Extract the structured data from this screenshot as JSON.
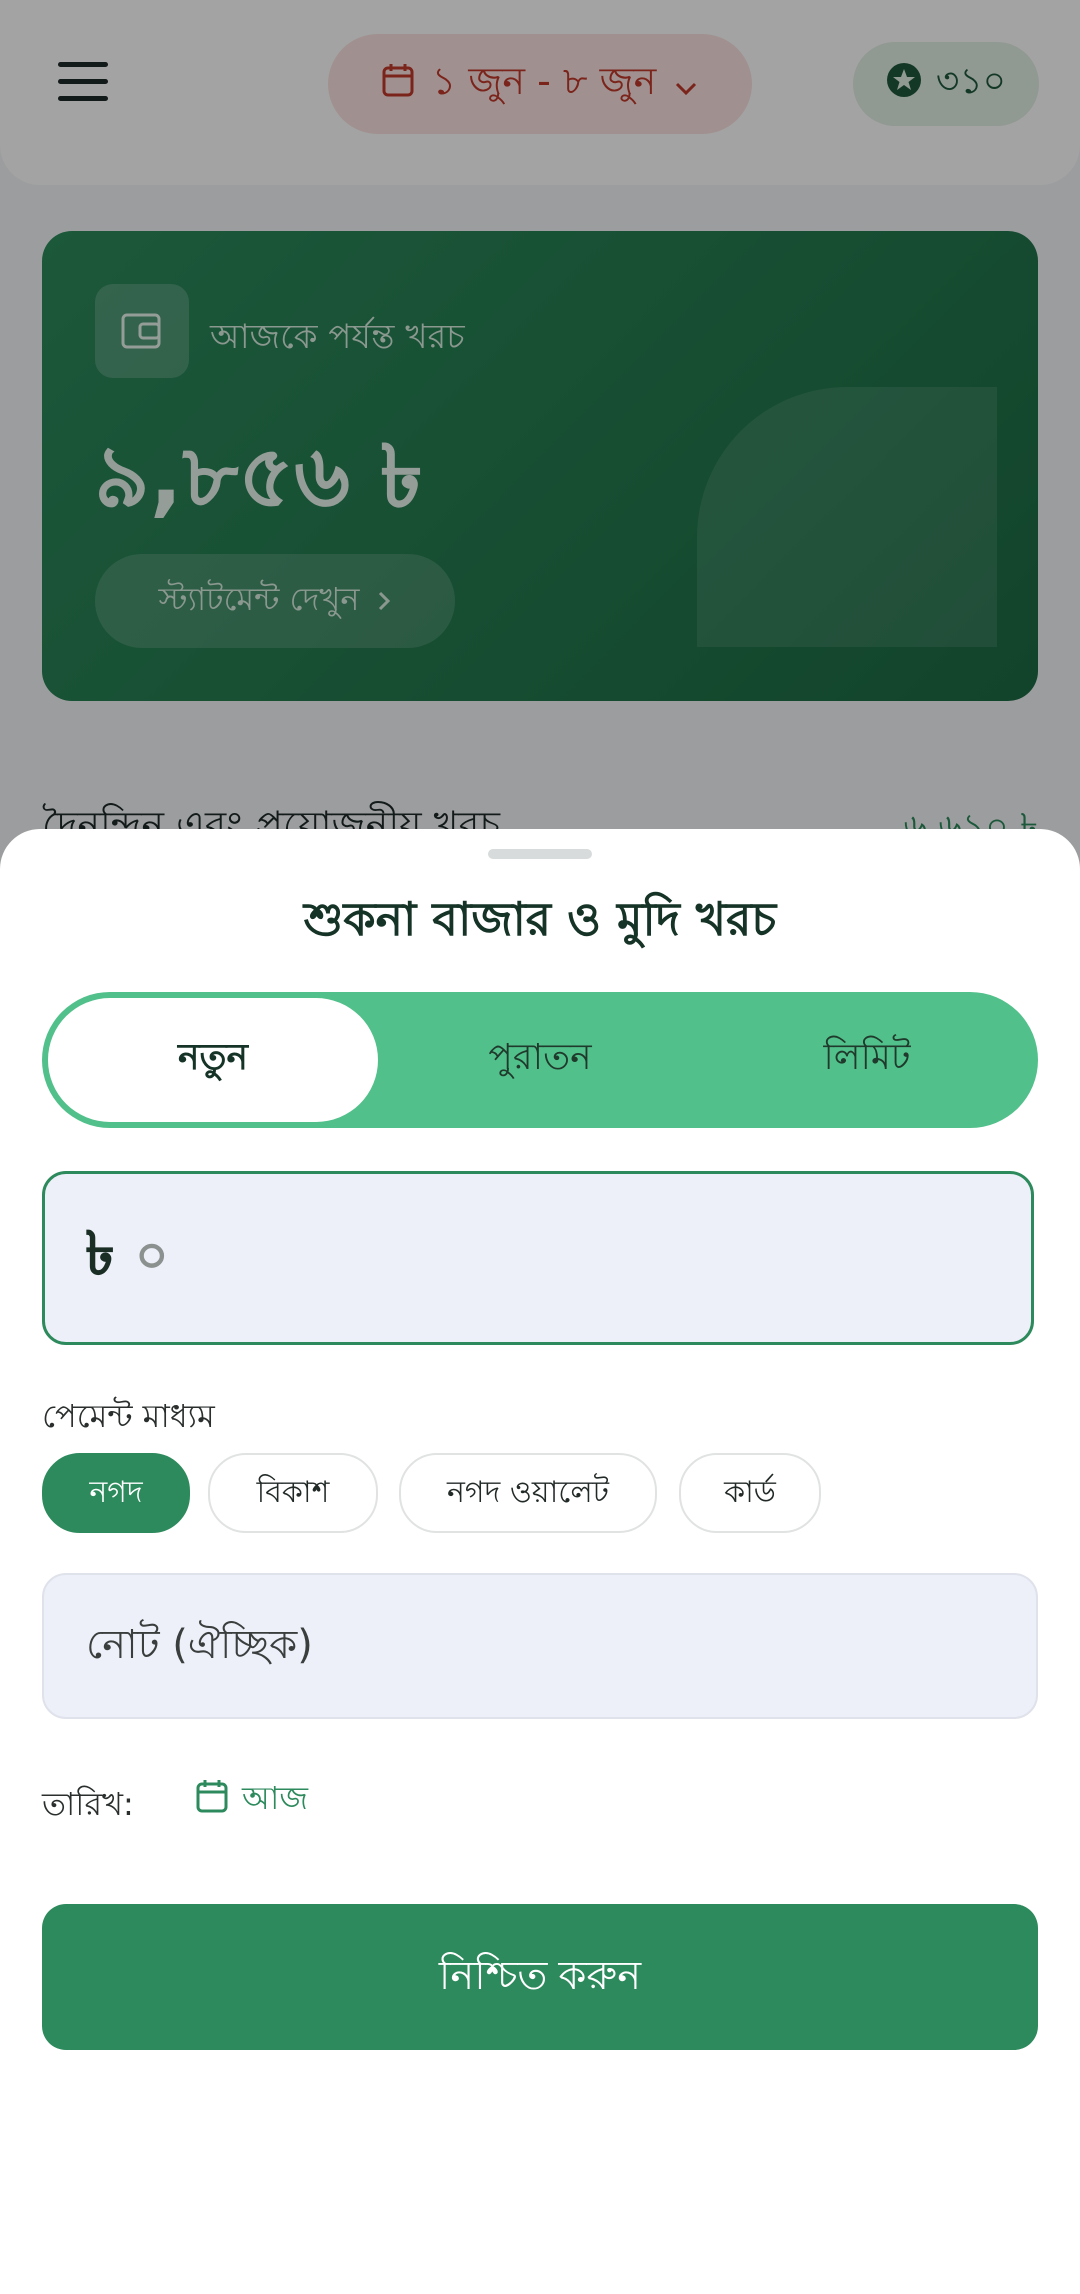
{
  "header": {
    "date_range": "১ জুন - ৮ জুন",
    "points": "৩১০"
  },
  "summary_card": {
    "caption": "আজকে পর্যন্ত খরচ",
    "amount": "৯,৮৫৬ ৳",
    "statement_label": "স্ট্যাটমেন্ট দেখুন"
  },
  "section": {
    "title": "দৈনন্দিন এবং প্রয়োজনীয় খরচ",
    "amount": "৬,৬১০ ৳"
  },
  "sheet": {
    "title": "শুকনা বাজার ও মুদি খরচ",
    "tabs": [
      "নতুন",
      "পুরাতন",
      "লিমিট"
    ],
    "active_tab": "নতুন",
    "amount_currency": "৳",
    "amount_value": "০",
    "payment_label": "পেমেন্ট মাধ্যম",
    "payment_methods": [
      "নগদ",
      "বিকাশ",
      "নগদ ওয়ালেট",
      "কার্ড"
    ],
    "selected_payment": "নগদ",
    "note_placeholder": "নোট (ঐচ্ছিক)",
    "date_label": "তারিখ:",
    "date_value": "আজ",
    "confirm_label": "নিশ্চিত করুন"
  },
  "colors": {
    "accent": "#2d8a5c",
    "tab_bar": "#52c08a",
    "date_pill_text": "#c0392b",
    "input_bg": "#eef0f9"
  },
  "icons": [
    "menu-icon",
    "calendar-icon",
    "chevron-down-icon",
    "star-icon",
    "wallet-icon",
    "chevron-right-icon"
  ]
}
